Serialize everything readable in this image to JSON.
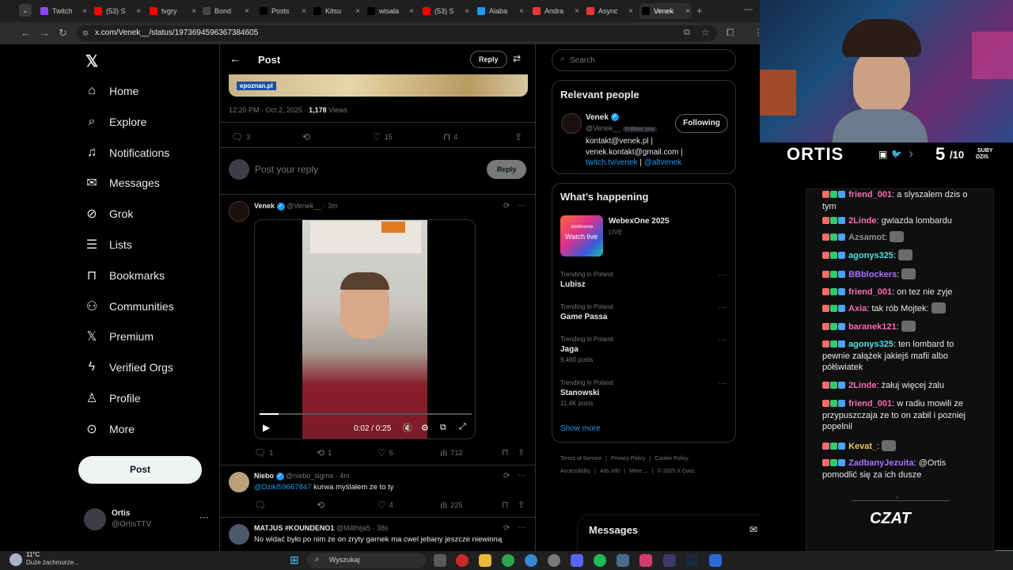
{
  "browser": {
    "tabs": [
      {
        "label": "Twitch",
        "color": "#9146ff"
      },
      {
        "label": "(53) S",
        "color": "#ff0000"
      },
      {
        "label": "tvgry",
        "color": "#ff0000"
      },
      {
        "label": "Bond",
        "color": "#444444"
      },
      {
        "label": "Posts",
        "color": "#000000"
      },
      {
        "label": "Kitsu",
        "color": "#000000"
      },
      {
        "label": "wisala",
        "color": "#000000"
      },
      {
        "label": "(53) S",
        "color": "#ff0000"
      },
      {
        "label": "Alaba",
        "color": "#1d9bf0"
      },
      {
        "label": "Andra",
        "color": "#e53935"
      },
      {
        "label": "Async",
        "color": "#e53935"
      },
      {
        "label": "Venek",
        "color": "#000000"
      }
    ],
    "url": "x.com/Venek__/status/1973694596367384605"
  },
  "sidebar": {
    "items": [
      {
        "label": "Home",
        "icon": "home-icon"
      },
      {
        "label": "Explore",
        "icon": "search-icon"
      },
      {
        "label": "Notifications",
        "icon": "bell-icon"
      },
      {
        "label": "Messages",
        "icon": "mail-icon"
      },
      {
        "label": "Grok",
        "icon": "grok-icon"
      },
      {
        "label": "Lists",
        "icon": "list-icon"
      },
      {
        "label": "Bookmarks",
        "icon": "bookmark-icon"
      },
      {
        "label": "Communities",
        "icon": "people-icon"
      },
      {
        "label": "Premium",
        "icon": "x-logo-icon"
      },
      {
        "label": "Verified Orgs",
        "icon": "lightning-icon"
      },
      {
        "label": "Profile",
        "icon": "person-icon"
      },
      {
        "label": "More",
        "icon": "more-circle-icon"
      }
    ],
    "post_button": "Post",
    "account": {
      "name": "Ortis",
      "handle": "@OrtisTTV"
    }
  },
  "header": {
    "title": "Post",
    "reply_button": "Reply"
  },
  "main_post": {
    "image_tag": "epoznan.pl",
    "timestamp": "12:20 PM · Oct 2, 2025 · ",
    "views_count": "1,178",
    "views_label": "Views",
    "stats": {
      "replies": "3",
      "retweets": "",
      "likes": "15",
      "bookmarks": "4"
    },
    "reply_placeholder": "Post your reply",
    "reply_button": "Reply"
  },
  "replies": [
    {
      "name": "Venek",
      "handle": "@Venek__ · 3m",
      "video_time": "0:02 / 0:25",
      "stats": {
        "replies": "1",
        "retweets": "1",
        "likes": "5",
        "views": "712"
      }
    },
    {
      "name": "Niebo",
      "handle": "@niebo_sigma · 4m",
      "mention": "@Dzikl59667847",
      "text": "kurwa myślałem że to ty",
      "stats": {
        "replies": "",
        "retweets": "",
        "likes": "4",
        "views": "225"
      }
    },
    {
      "name": "MATJUS #KOUNDENO1",
      "handle": "@M4thija5 · 38s",
      "text": "No widać było po nim że on zryty garnek ma cwel jebany jeszcze niewinną"
    }
  ],
  "right": {
    "search_placeholder": "Search",
    "relevant_title": "Relevant people",
    "person": {
      "name": "Venek",
      "handle": "@Venek__",
      "follows_you": "Follows you",
      "button": "Following",
      "bio_line1": "kontakt@venek.pl |",
      "bio_line2": "venek.kontakt@gmail.com |",
      "bio_link1": "twitch.tv/venek",
      "bio_sep": " | ",
      "bio_link2": "@altvenek"
    },
    "happening_title": "What’s happening",
    "event": {
      "name": "WebexOne 2025",
      "status": "LIVE",
      "thumb_text": "Watch live",
      "thumb_brand": "webexone"
    },
    "trends": [
      {
        "category": "Trending in Poland",
        "name": "Lubisz",
        "count": ""
      },
      {
        "category": "Trending in Poland",
        "name": "Game Passa",
        "count": ""
      },
      {
        "category": "Trending in Poland",
        "name": "Jaga",
        "count": "9,460 posts"
      },
      {
        "category": "Trending in Poland",
        "name": "Stanowski",
        "count": "11.4K posts"
      }
    ],
    "show_more": "Show more",
    "footer_row1": [
      "Terms of Service",
      "Privacy Policy",
      "Cookie Policy"
    ],
    "footer_row2": [
      "Accessibility",
      "Ads info",
      "More ...",
      "© 2025 X Corp."
    ],
    "messages_drawer": "Messages"
  },
  "overlay": {
    "streamer_name": "ORTIS",
    "subs_current": "5",
    "subs_goal": "/10",
    "subs_label1": "SUBY",
    "subs_label2": "DZIS",
    "chat_logo": "CZAT"
  },
  "chat": [
    {
      "user": "friend_001",
      "color": "#ff69b4",
      "text": "a slyszalem dzis o tym"
    },
    {
      "user": "2Linde",
      "color": "#ff69b4",
      "text": "gwiazda lombardu"
    },
    {
      "user": "Azsamot",
      "color": "#8f8f8f",
      "text": ""
    },
    {
      "user": "agonys325",
      "color": "#4ee1e1",
      "text": ""
    },
    {
      "user": "BBblockers",
      "color": "#a970ff",
      "text": ""
    },
    {
      "user": "friend_001",
      "color": "#ff69b4",
      "text": "on tez nie zyje"
    },
    {
      "user": "Axia",
      "color": "#ff69b4",
      "text": "tak rób Mojtek:"
    },
    {
      "user": "baranek121",
      "color": "#ff69b4",
      "text": ""
    },
    {
      "user": "agonys325",
      "color": "#4ee1e1",
      "text": "ten lombard to pewnie załążek jakiejś mafii albo półświatek"
    },
    {
      "user": "2Linde",
      "color": "#ff69b4",
      "text": "żałuj więcej żalu"
    },
    {
      "user": "friend_001",
      "color": "#ff69b4",
      "text": "w radiu mowili ze przypuszczaja ze to on zabil i pozniej popelnil"
    },
    {
      "user": "Kevat_",
      "color": "#e6c84c",
      "text": ""
    },
    {
      "user": "ZadbanyJezuita",
      "color": "#a970ff",
      "text": "@Ortis pomodlić się za ich dusze"
    }
  ],
  "taskbar": {
    "weather_temp": "11°C",
    "weather_desc": "Duże zachmurze...",
    "search": "Wyszukaj"
  }
}
